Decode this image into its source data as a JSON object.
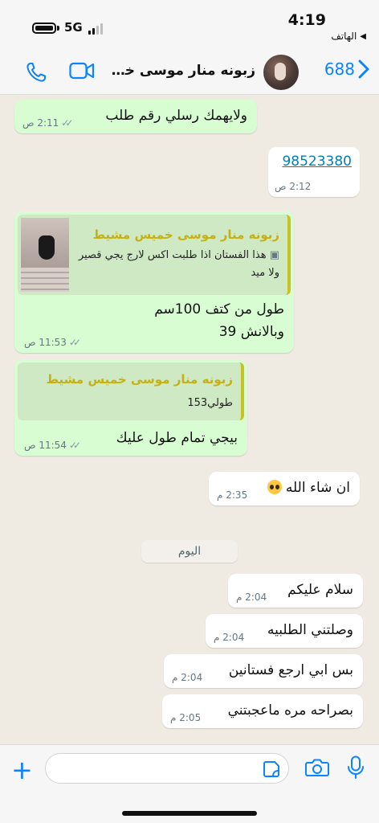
{
  "status_bar": {
    "time": "4:19",
    "back_app": "الهاتف",
    "network": "5G"
  },
  "header": {
    "back_count": "688",
    "contact_name": "زبونه منار موسى خميس مشيط"
  },
  "messages": [
    {
      "dir": "sent",
      "text": "ولايهمك رسلي رقم طلب",
      "time": "2:11 ص"
    },
    {
      "dir": "recv",
      "text": "98523380",
      "time": "2:12 ص"
    },
    {
      "dir": "sent",
      "quote_name": "زبونه منار موسى خميس مشيط",
      "quote_text": "هذا الفستان اذا طلبت اكس لارج يجي قصير ولا ميد",
      "text_line1": "طول من كتف 100سم",
      "text_line2": "وبالانش 39",
      "time": "11:53 ص"
    },
    {
      "dir": "sent",
      "quote_name": "زبونه منار موسى خميس مشيط",
      "quote_text": "طولي153",
      "text": "بيجي تمام طول عليك",
      "time": "11:54 ص"
    },
    {
      "dir": "recv",
      "text": "ان شاء الله",
      "time": "2:35 م"
    },
    {
      "dir": "recv",
      "text": "سلام عليكم",
      "time": "2:04 م"
    },
    {
      "dir": "recv",
      "text": "وصلتني الطلبيه",
      "time": "2:04 م"
    },
    {
      "dir": "recv",
      "text": "بس ابي ارجع فستانين",
      "time": "2:04 م"
    },
    {
      "dir": "recv",
      "text": "بصراحه مره ماعجبتني",
      "time": "2:05 م"
    }
  ],
  "day_separator": "اليوم",
  "composer": {
    "placeholder": "",
    "value": ""
  },
  "colors": {
    "accent": "#0a84ff",
    "sent_bubble": "#d9fdd3",
    "recv_bubble": "#ffffff",
    "quote_name": "#c4b115",
    "chat_bg": "#efeae2"
  },
  "icons": [
    "phone-icon",
    "video-icon",
    "camera-icon",
    "mic-icon",
    "plus-icon",
    "sticker-icon",
    "chevron-left-icon",
    "ticks-icon"
  ]
}
